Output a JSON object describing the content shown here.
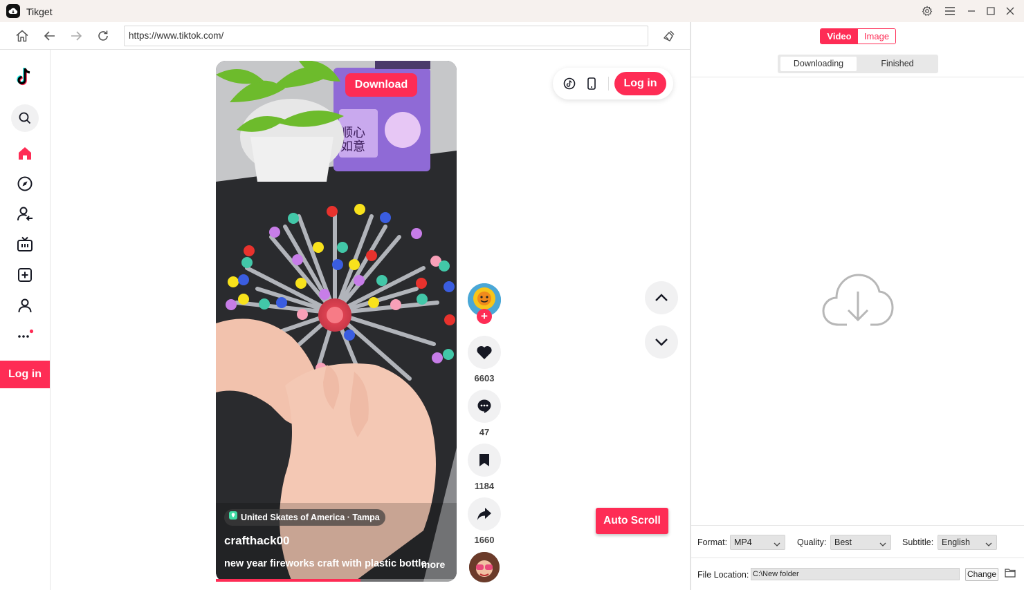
{
  "app": {
    "title": "Tikget"
  },
  "browser": {
    "url": "https://www.tiktok.com/"
  },
  "sidebar": {
    "login_label": "Log in",
    "items": [
      "search-icon",
      "home-icon",
      "explore-icon",
      "following-icon",
      "live-icon",
      "upload-icon",
      "profile-icon",
      "more-icon"
    ]
  },
  "video": {
    "download_label": "Download",
    "location": "United Skates of America · Tampa",
    "author": "crafthack00",
    "caption": "new year fireworks craft with plastic bottle",
    "more_label": "more",
    "progress": 0.6
  },
  "actions": {
    "likes": "6603",
    "comments": "47",
    "saves": "1184",
    "shares": "1660"
  },
  "top_bar": {
    "login_label": "Log in"
  },
  "auto_scroll_label": "Auto Scroll",
  "panel": {
    "tabs": [
      "Video",
      "Image"
    ],
    "active_tab": "Video",
    "subtabs": [
      "Downloading",
      "Finished"
    ],
    "active_subtab": "Downloading",
    "format_label": "Format:",
    "format_value": "MP4",
    "quality_label": "Quality:",
    "quality_value": "Best",
    "subtitle_label": "Subtitle:",
    "subtitle_value": "English",
    "location_label": "File Location:",
    "location_value": "C:\\New folder",
    "change_label": "Change"
  },
  "colors": {
    "accent": "#fe2c55",
    "panel_bg": "#ffffff",
    "titlebar_bg": "#f6f1ee"
  }
}
